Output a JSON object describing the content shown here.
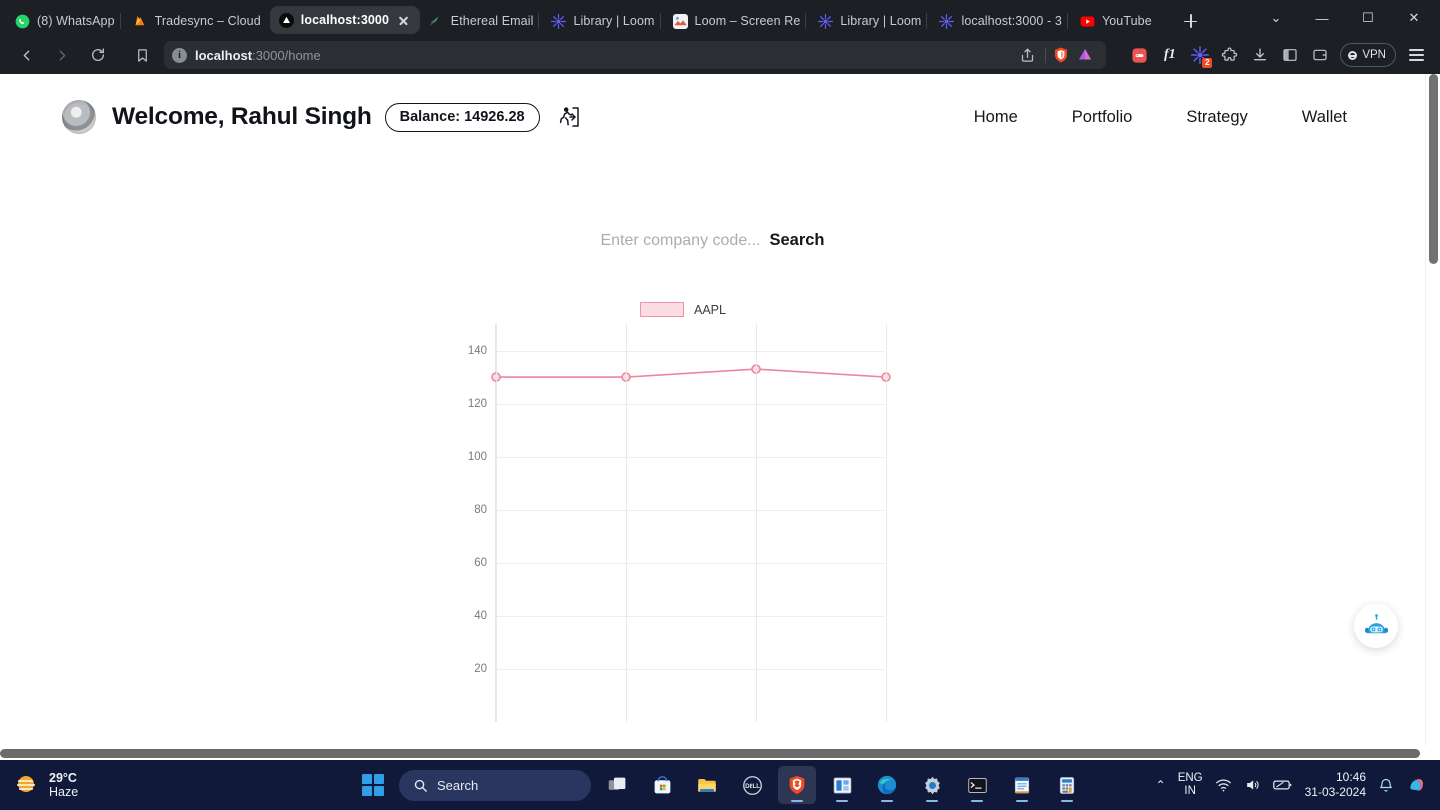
{
  "browser": {
    "tabs": [
      {
        "title": "(8) WhatsApp",
        "icon": "whatsapp-icon",
        "active": false
      },
      {
        "title": "Tradesync – Cloud",
        "icon": "firebase-icon",
        "active": false
      },
      {
        "title": "localhost:3000",
        "icon": "vercel-icon",
        "active": true
      },
      {
        "title": "Ethereal Email",
        "icon": "ethereal-icon",
        "active": false
      },
      {
        "title": "Library | Loom",
        "icon": "loom-icon",
        "active": false
      },
      {
        "title": "Loom – Screen Re",
        "icon": "loom-video-icon",
        "active": false
      },
      {
        "title": "Library | Loom",
        "icon": "loom-icon",
        "active": false
      },
      {
        "title": "localhost:3000 - 3",
        "icon": "loom-icon",
        "active": false
      },
      {
        "title": "YouTube",
        "icon": "youtube-icon",
        "active": false
      }
    ],
    "new_tab_label": "+",
    "window_controls": {
      "minimize": "—",
      "maximize": "☐",
      "close": "✕",
      "tabsearch": "⌄"
    },
    "address": {
      "prefix": "localhost",
      "suffix": ":3000/home",
      "info_icon": "info-icon"
    },
    "nav": {
      "back": "back-icon",
      "forward": "forward-icon",
      "reload": "reload-icon",
      "bookmark": "bookmark-icon"
    },
    "toolbar": {
      "share_icon": "share-icon",
      "brave_shield": "brave-shields-icon",
      "brave_rewards": "brave-rewards-icon",
      "extension_badge": "2",
      "vpn_label": "VPN",
      "menu": "hamburger-menu-icon"
    }
  },
  "page": {
    "avatar_alt": "user-avatar",
    "welcome_text": "Welcome, Rahul Singh",
    "balance_label": "Balance: 14926.28",
    "logout_icon": "logout-run-icon",
    "nav_links": [
      {
        "label": "Home"
      },
      {
        "label": "Portfolio"
      },
      {
        "label": "Strategy"
      },
      {
        "label": "Wallet"
      }
    ],
    "search": {
      "value": "",
      "placeholder": "Enter company code...",
      "button_label": "Search"
    },
    "chat_fab_icon": "robot-chat-icon"
  },
  "chart_data": {
    "type": "line",
    "title": "",
    "legend": [
      {
        "name": "AAPL",
        "fill": "#fbdde3",
        "stroke": "#f093a8"
      }
    ],
    "legend_position": "top-center",
    "grid": true,
    "series": [
      {
        "name": "AAPL",
        "values": [
          130,
          130,
          133,
          130
        ],
        "color": "#e8899f"
      }
    ],
    "x": [
      1,
      2,
      3,
      4
    ],
    "xlabel": "",
    "ylabel": "",
    "yticks": [
      140,
      120,
      100,
      80,
      60,
      40,
      20
    ],
    "ylim": [
      0,
      150
    ],
    "xtick_labels": [
      "",
      "",
      "",
      ""
    ]
  },
  "taskbar": {
    "weather": {
      "temperature": "29°C",
      "condition": "Haze",
      "icon": "haze-sun-icon"
    },
    "start_icon": "windows-start-icon",
    "search": {
      "placeholder": "Search",
      "icon": "search-icon"
    },
    "apps": [
      {
        "name": "task-view-icon"
      },
      {
        "name": "microsoft-store-icon"
      },
      {
        "name": "file-explorer-icon"
      },
      {
        "name": "dell-icon"
      },
      {
        "name": "brave-browser-icon"
      },
      {
        "name": "office-word-icon"
      },
      {
        "name": "microsoft-edge-icon"
      },
      {
        "name": "settings-gear-icon"
      },
      {
        "name": "terminal-icon"
      },
      {
        "name": "notepad-icon"
      },
      {
        "name": "calculator-icon"
      }
    ],
    "tray": {
      "chevron": "⌃",
      "language_primary": "ENG",
      "language_secondary": "IN",
      "wifi_icon": "wifi-icon",
      "volume_icon": "volume-icon",
      "battery_icon": "battery-icon",
      "time": "10:46",
      "date": "31-03-2024",
      "notification_icon": "bell-icon",
      "copilot_icon": "copilot-icon"
    }
  }
}
